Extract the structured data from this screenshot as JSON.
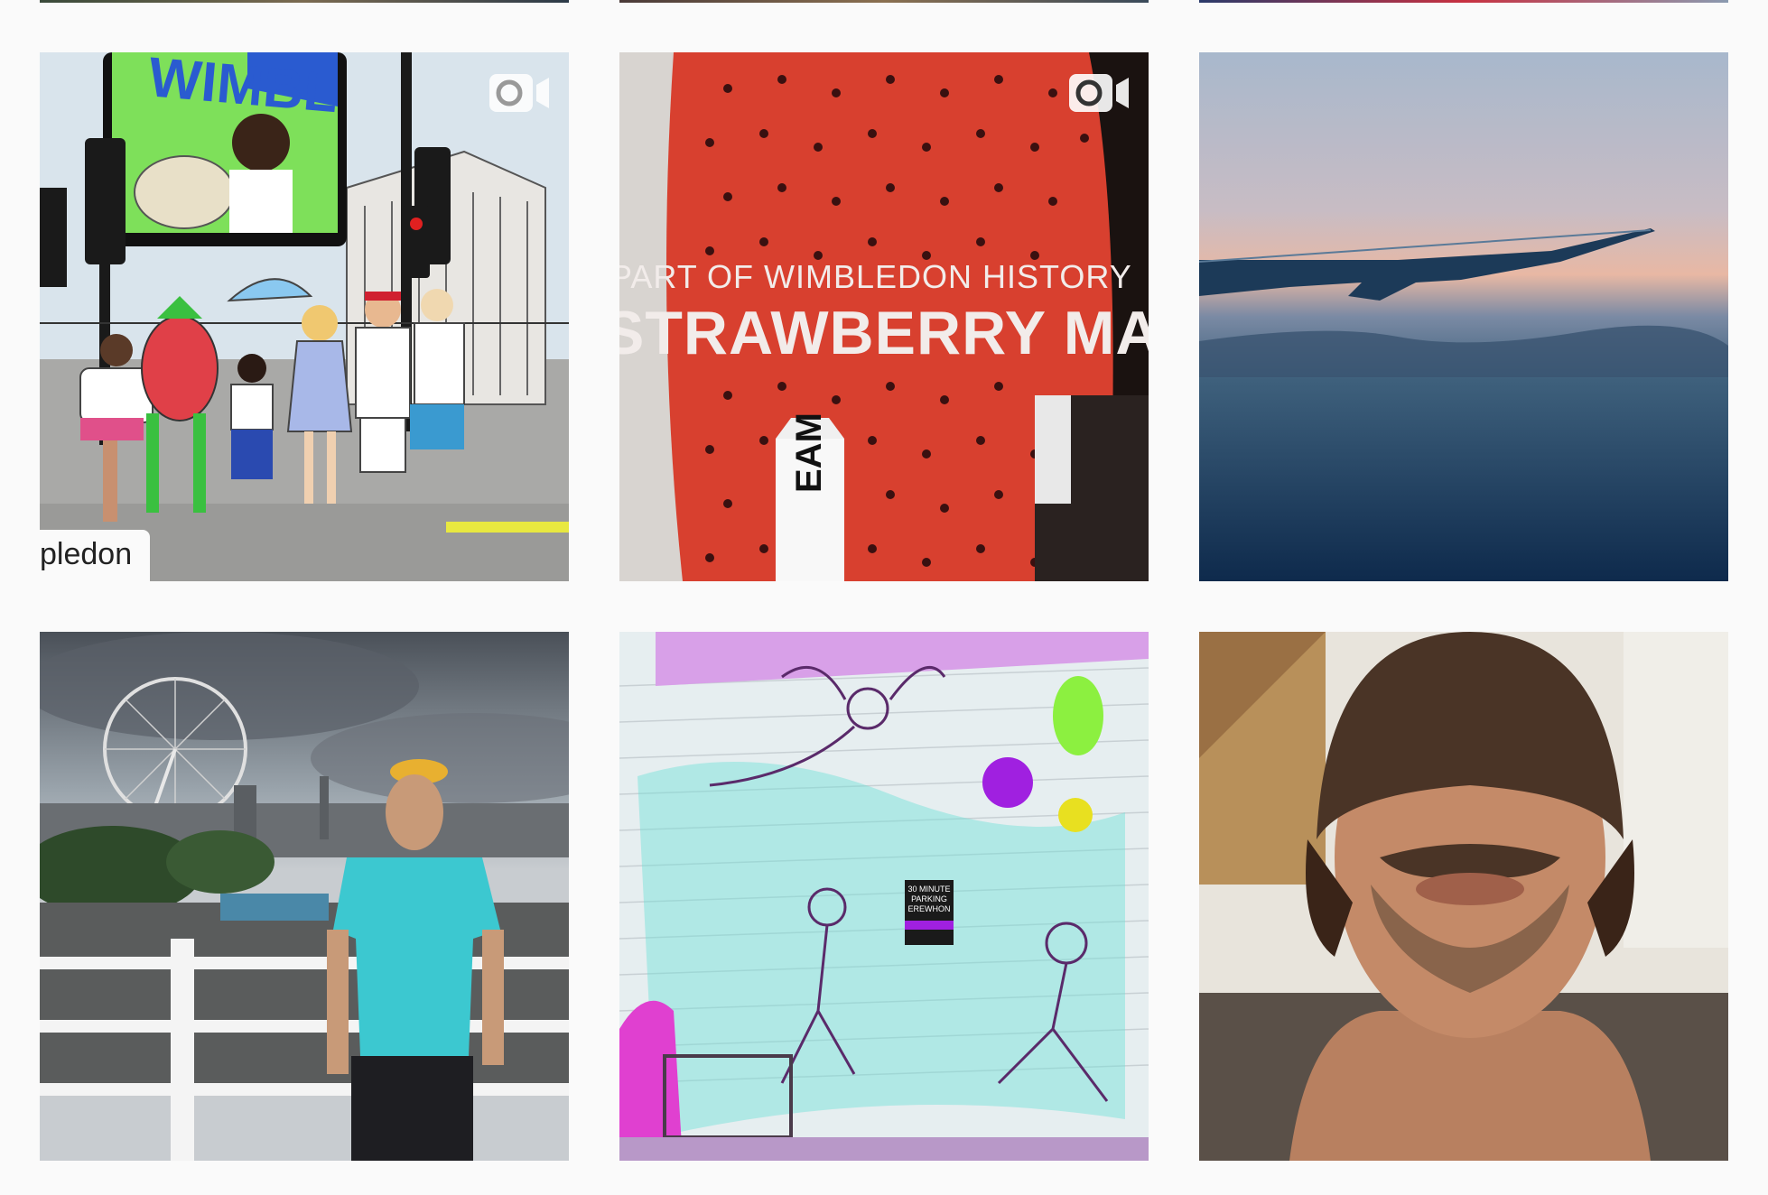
{
  "grid": {
    "posts": [
      {
        "id": "post-1",
        "type": "video",
        "caption_overlay": "pledon",
        "banner_text": "WIMBL"
      },
      {
        "id": "post-2",
        "type": "video",
        "overlay_line_1": "PART OF WIMBLEDON HISTORY",
        "overlay_line_2": "STRAWBERRY MAN",
        "carton_text": "EAM"
      },
      {
        "id": "post-3",
        "type": "photo"
      },
      {
        "id": "post-4",
        "type": "photo"
      },
      {
        "id": "post-5",
        "type": "photo",
        "sign_text": "30 MINUTE PARKING EREWHON"
      },
      {
        "id": "post-6",
        "type": "photo"
      }
    ]
  },
  "icons": {
    "video": "video-camera-icon"
  },
  "colors": {
    "background": "#fafafa",
    "icon": "#ffffff"
  }
}
